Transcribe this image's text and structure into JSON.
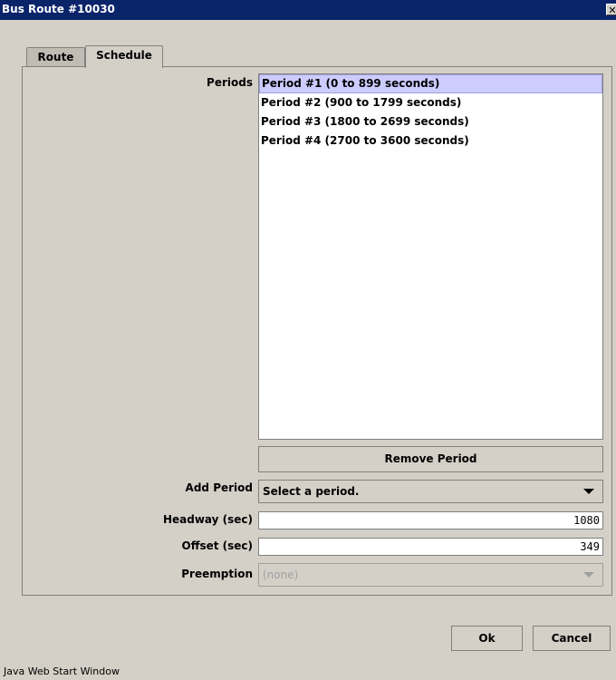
{
  "window": {
    "title": "Bus Route #10030",
    "close_glyph": "✕",
    "status_text": "Java Web Start Window"
  },
  "tabs": [
    {
      "label": "Route"
    },
    {
      "label": "Schedule",
      "selected": true
    }
  ],
  "schedule": {
    "periods_label": "Periods",
    "periods": [
      {
        "label": "Period #1 (0 to 899 seconds)",
        "selected": true
      },
      {
        "label": "Period #2 (900 to 1799 seconds)"
      },
      {
        "label": "Period #3 (1800 to 2699 seconds)"
      },
      {
        "label": "Period #4 (2700 to 3600 seconds)"
      }
    ],
    "remove_period_label": "Remove Period",
    "add_period_label": "Add Period",
    "add_period_value": "Select a period.",
    "headway_label": "Headway (sec)",
    "headway_value": "1080",
    "offset_label": "Offset (sec)",
    "offset_value": "349",
    "preemption_label": "Preemption",
    "preemption_value": "(none)"
  },
  "buttons": {
    "ok": "Ok",
    "cancel": "Cancel"
  },
  "colors": {
    "titlebar": "#0a246a",
    "selection": "#ccccff",
    "window_bg": "#d4d0c8"
  }
}
